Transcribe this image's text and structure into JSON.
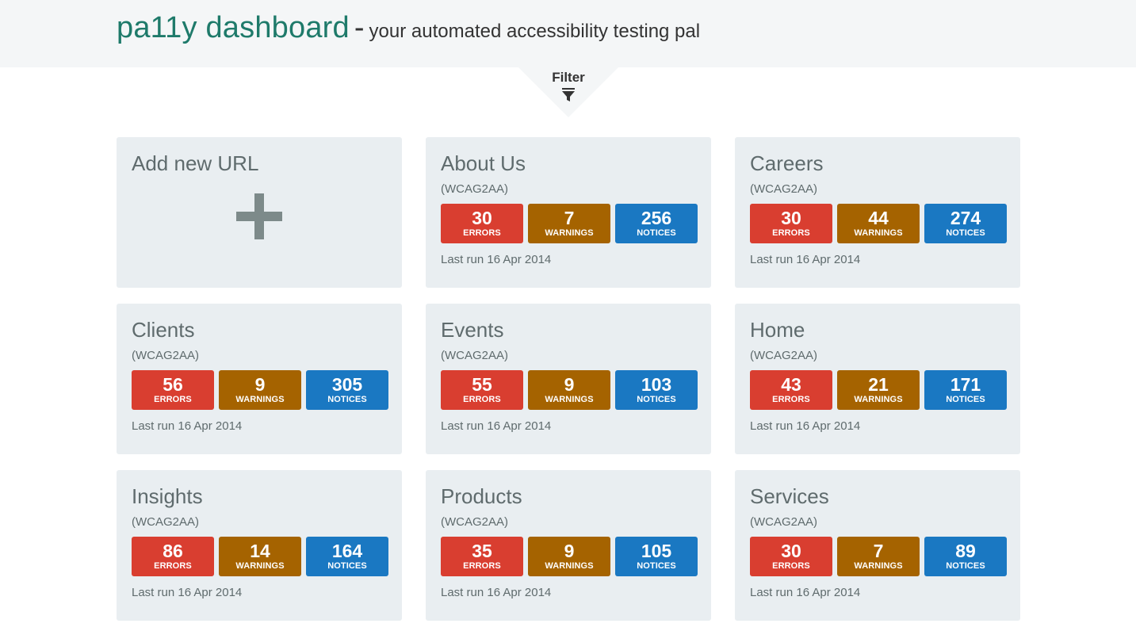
{
  "header": {
    "brand": "pa11y dashboard",
    "separator": "-",
    "tagline": "your automated accessibility testing pal"
  },
  "filter": {
    "label": "Filter",
    "icon": "filter-icon"
  },
  "add_card": {
    "title": "Add new URL",
    "icon": "plus-icon"
  },
  "colors": {
    "errors": "#d93e30",
    "warnings": "#a56300",
    "notices": "#1a78c2",
    "brand": "#1e7a6a"
  },
  "stat_labels": {
    "errors": "ERRORS",
    "warnings": "WARNINGS",
    "notices": "NOTICES"
  },
  "tasks": [
    {
      "name": "About Us",
      "standard": "(WCAG2AA)",
      "errors": "30",
      "warnings": "7",
      "notices": "256",
      "last_run": "Last run 16 Apr 2014"
    },
    {
      "name": "Careers",
      "standard": "(WCAG2AA)",
      "errors": "30",
      "warnings": "44",
      "notices": "274",
      "last_run": "Last run 16 Apr 2014"
    },
    {
      "name": "Clients",
      "standard": "(WCAG2AA)",
      "errors": "56",
      "warnings": "9",
      "notices": "305",
      "last_run": "Last run 16 Apr 2014"
    },
    {
      "name": "Events",
      "standard": "(WCAG2AA)",
      "errors": "55",
      "warnings": "9",
      "notices": "103",
      "last_run": "Last run 16 Apr 2014"
    },
    {
      "name": "Home",
      "standard": "(WCAG2AA)",
      "errors": "43",
      "warnings": "21",
      "notices": "171",
      "last_run": "Last run 16 Apr 2014"
    },
    {
      "name": "Insights",
      "standard": "(WCAG2AA)",
      "errors": "86",
      "warnings": "14",
      "notices": "164",
      "last_run": "Last run 16 Apr 2014"
    },
    {
      "name": "Products",
      "standard": "(WCAG2AA)",
      "errors": "35",
      "warnings": "9",
      "notices": "105",
      "last_run": "Last run 16 Apr 2014"
    },
    {
      "name": "Services",
      "standard": "(WCAG2AA)",
      "errors": "30",
      "warnings": "7",
      "notices": "89",
      "last_run": "Last run 16 Apr 2014"
    }
  ]
}
